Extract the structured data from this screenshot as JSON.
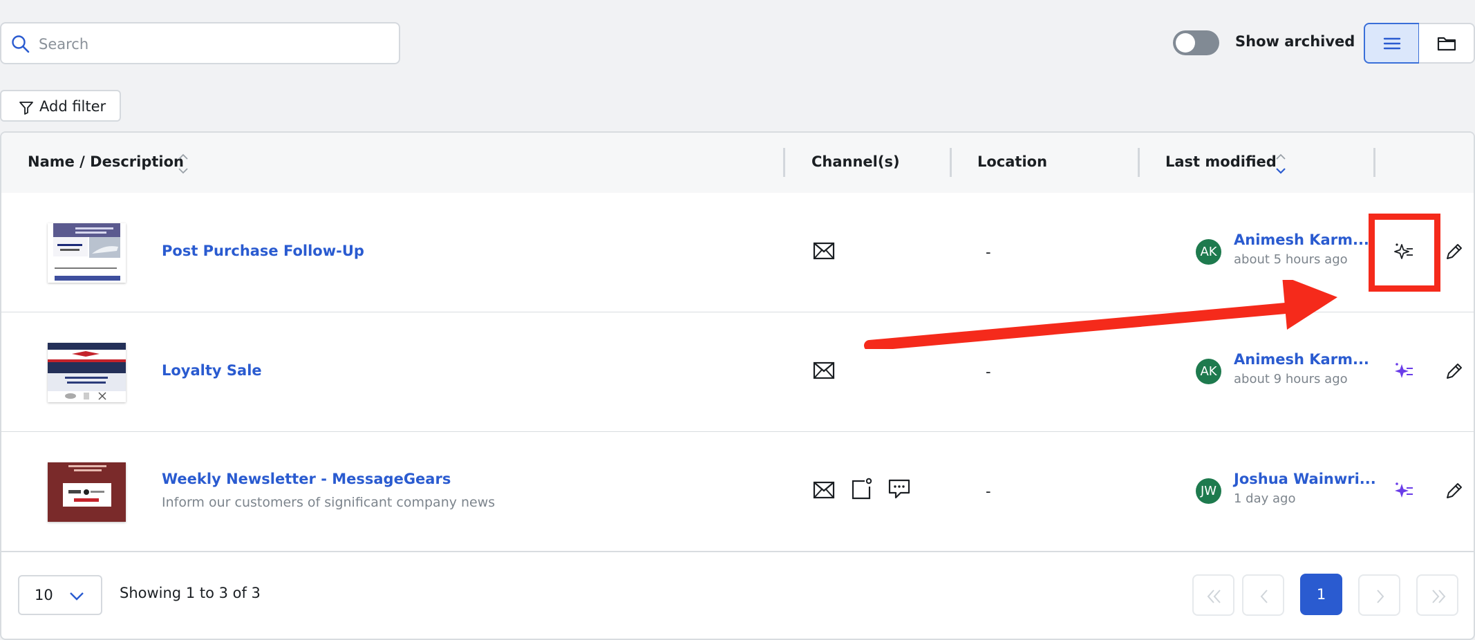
{
  "toolbar": {
    "search_placeholder": "Search",
    "show_archived_label": "Show archived",
    "show_archived_on": false,
    "add_filter_label": "Add filter",
    "active_view": "list"
  },
  "table": {
    "columns": {
      "name": "Name / Description",
      "channels": "Channel(s)",
      "location": "Location",
      "modified": "Last modified"
    },
    "rows": [
      {
        "name": "Post Purchase Follow-Up",
        "description": "",
        "channels": [
          "email-icon"
        ],
        "location": "-",
        "initials": "AK",
        "owner": "Animesh Karm...",
        "modified": "about 5 hours ago"
      },
      {
        "name": "Loyalty Sale",
        "description": "",
        "channels": [
          "email-icon"
        ],
        "location": "-",
        "initials": "AK",
        "owner": "Animesh Karm...",
        "modified": "about 9 hours ago"
      },
      {
        "name": "Weekly Newsletter - MessageGears",
        "description": "Inform our customers of significant company news",
        "channels": [
          "email-icon",
          "push-notification-icon",
          "sms-icon"
        ],
        "location": "-",
        "initials": "JW",
        "owner": "Joshua Wainwri...",
        "modified": "1 day ago"
      }
    ]
  },
  "footer": {
    "page_size": "10",
    "showing_text": "Showing 1 to 3 of 3",
    "current_page": "1"
  },
  "colors": {
    "link": "#2a5bd0",
    "avatar": "#1e7a4e",
    "ai_icon": "#6a3de8",
    "annotation": "#f52a1b"
  }
}
